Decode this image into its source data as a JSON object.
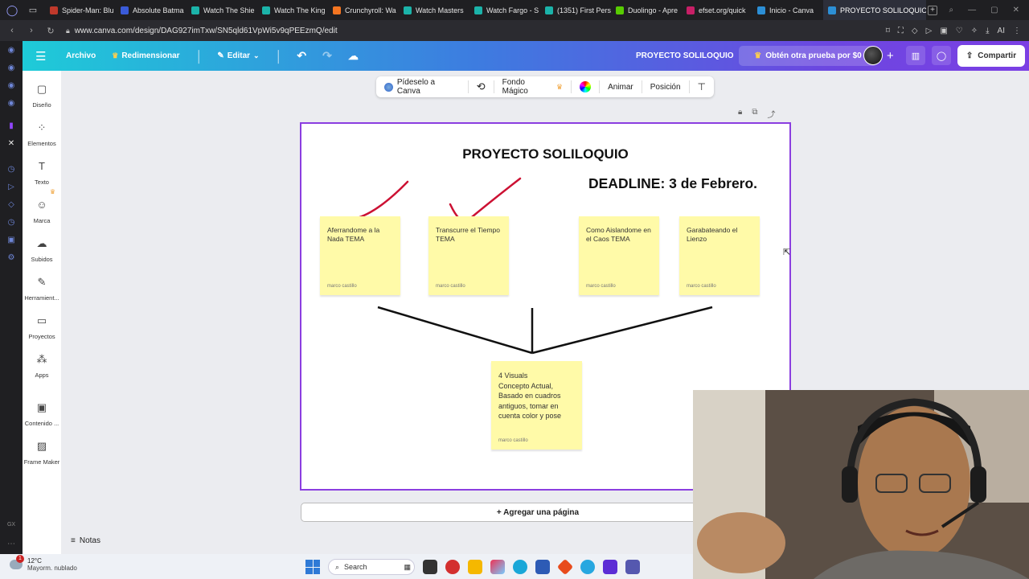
{
  "browser": {
    "tabs": [
      {
        "label": "Spider-Man: Blu",
        "color": "#c0392b"
      },
      {
        "label": "Absolute Batma",
        "color": "#3a5bd9"
      },
      {
        "label": "Watch The Shie",
        "color": "#1bb3a9"
      },
      {
        "label": "Watch The King",
        "color": "#1bb3a9"
      },
      {
        "label": "Crunchyroll: Wa",
        "color": "#f47521"
      },
      {
        "label": "Watch Masters",
        "color": "#1bb3a9"
      },
      {
        "label": "Watch Fargo - S",
        "color": "#1bb3a9"
      },
      {
        "label": "(1351) First Pers",
        "color": "#1bb3a9"
      },
      {
        "label": "Duolingo - Apre",
        "color": "#58cc02"
      },
      {
        "label": "efset.org/quick",
        "color": "#c71f66"
      },
      {
        "label": "Inicio - Canva",
        "color": "#2c8fd6"
      },
      {
        "label": "PROYECTO SOLILOQUIO",
        "color": "#2c8fd6"
      }
    ],
    "url": "www.canva.com/design/DAG927imTxw/SN5qld61VpWi5v9qPEEzmQ/edit"
  },
  "header": {
    "archivo": "Archivo",
    "redimensionar": "Redimensionar",
    "editar": "Editar",
    "title": "PROYECTO SOLILOQUIO",
    "trial": "Obtén otra prueba por $0",
    "share": "Compartir"
  },
  "sidebar": {
    "items": [
      {
        "label": "Diseño",
        "icon": "layout-icon"
      },
      {
        "label": "Elementos",
        "icon": "shapes-icon"
      },
      {
        "label": "Texto",
        "icon": "text-icon"
      },
      {
        "label": "Marca",
        "icon": "brand-icon"
      },
      {
        "label": "Subidos",
        "icon": "upload-cloud-icon"
      },
      {
        "label": "Herramient...",
        "icon": "pen-tool-icon"
      },
      {
        "label": "Proyectos",
        "icon": "folder-icon"
      },
      {
        "label": "Apps",
        "icon": "apps-icon"
      },
      {
        "label": "Contenido ...",
        "icon": "image-icon"
      },
      {
        "label": "Frame Maker",
        "icon": "frame-icon"
      }
    ]
  },
  "toolbar": {
    "ask_canva": "Pídeselo a Canva",
    "magic_bg": "Fondo Mágico",
    "animate": "Animar",
    "position": "Posición"
  },
  "page": {
    "title": "PROYECTO SOLILOQUIO",
    "deadline": "DEADLINE: 3 de Febrero.",
    "notes": [
      {
        "text": "Aferrandome a la Nada  TEMA",
        "author": "marco castillo"
      },
      {
        "text": "Transcurre el Tiempo TEMA",
        "author": "marco castillo"
      },
      {
        "text": "Como Aislandome en el Caos TEMA",
        "author": "marco castillo"
      },
      {
        "text": "Garabateando el Lienzo",
        "author": "marco castillo"
      },
      {
        "text": "4 Visuals\n Concepto Actual, Basado en cuadros antiguos, tomar en cuenta color y pose",
        "author": "marco castillo"
      }
    ]
  },
  "add_page": "+ Agregar una página",
  "notes_label": "Notas",
  "taskbar": {
    "weather_temp": "12°C",
    "weather_desc": "Mayorm. nublado",
    "notification_count": "1",
    "search_placeholder": "Search"
  },
  "colors": {
    "accent_purple": "#8b3ee0",
    "sticky_yellow": "#fffaa8",
    "checkmark_red": "#cc1133"
  }
}
